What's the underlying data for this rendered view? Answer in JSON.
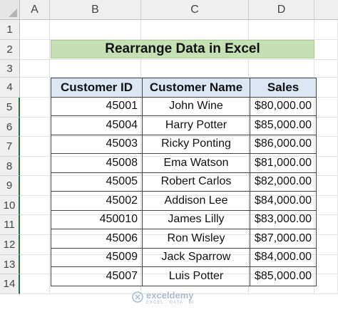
{
  "column_headers": [
    "A",
    "B",
    "C",
    "D"
  ],
  "row_headers": [
    "1",
    "2",
    "3",
    "4",
    "5",
    "6",
    "7",
    "8",
    "9",
    "10",
    "11",
    "12",
    "13",
    "14"
  ],
  "title": "Rearrange Data in Excel",
  "table": {
    "headers": [
      "Customer ID",
      "Customer Name",
      "Sales"
    ],
    "rows": [
      {
        "id": "45001",
        "name": "John Wine",
        "sales": "$80,000.00"
      },
      {
        "id": "45004",
        "name": "Harry Potter",
        "sales": "$85,000.00"
      },
      {
        "id": "45003",
        "name": "Ricky Ponting",
        "sales": "$86,000.00"
      },
      {
        "id": "45008",
        "name": "Ema Watson",
        "sales": "$81,000.00"
      },
      {
        "id": "45005",
        "name": "Robert Carlos",
        "sales": "$82,000.00"
      },
      {
        "id": "45002",
        "name": "Addison Lee",
        "sales": "$84,000.00"
      },
      {
        "id": "450010",
        "name": "James Lilly",
        "sales": "$83,000.00"
      },
      {
        "id": "45006",
        "name": "Ron Wisley",
        "sales": "$87,000.00"
      },
      {
        "id": "45009",
        "name": "Jack Sparrow",
        "sales": "$84,000.00"
      },
      {
        "id": "45007",
        "name": "Luis Potter",
        "sales": "$85,000.00"
      }
    ]
  },
  "watermark": {
    "name": "exceldemy",
    "tagline": "EXCEL · DATA · BI"
  },
  "colors": {
    "title_fill": "#c6e0b4",
    "header_fill": "#dce6f2",
    "selected_row_marker": "#217346"
  }
}
